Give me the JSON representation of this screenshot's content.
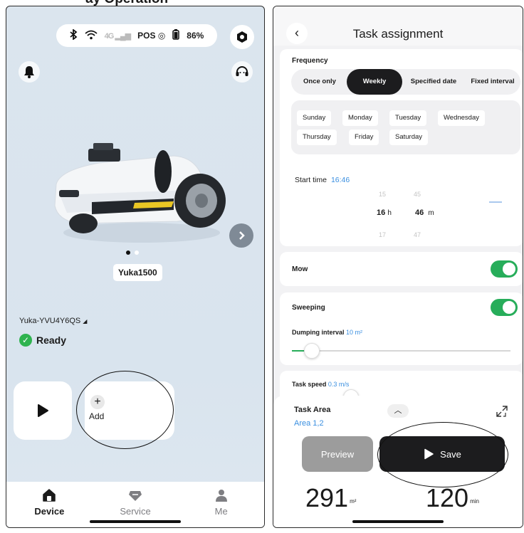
{
  "caption": "ay Operation",
  "left": {
    "status": {
      "bluetooth": "bluetooth-icon",
      "wifi": "wifi-icon",
      "cellular": "4G",
      "pos": "POS",
      "battery_pct": "86%"
    },
    "model": "Yuka1500",
    "carousel": {
      "count": 2,
      "active": 0
    },
    "device_id": "Yuka-YVU4Y6QS",
    "status_text": "Ready",
    "add_label": "Add",
    "nav": [
      {
        "label": "Device",
        "icon": "home-icon",
        "active": true
      },
      {
        "label": "Service",
        "icon": "diamond-icon",
        "active": false
      },
      {
        "label": "Me",
        "icon": "person-icon",
        "active": false
      }
    ],
    "colors": {
      "accent": "#2fb34f",
      "background": "#dbe5ee"
    }
  },
  "right": {
    "title": "Task assignment",
    "frequency_label": "Frequency",
    "frequency_options": [
      "Once only",
      "Weekly",
      "Specified date",
      "Fixed interval"
    ],
    "frequency_selected": "Weekly",
    "days_row1": [
      "Sunday",
      "Monday",
      "Tuesday",
      "Wednesday"
    ],
    "days_row2": [
      "Thursday",
      "Friday",
      "Saturday"
    ],
    "start_time_label": "Start time",
    "start_time_value": "16:46",
    "picker": {
      "hour_prev": "15",
      "hour": "16",
      "hour_next": "17",
      "h_unit": "h",
      "min_prev": "45",
      "min": "46",
      "min_next": "47",
      "m_unit": "m"
    },
    "mow_label": "Mow",
    "mow_on": true,
    "sweeping_label": "Sweeping",
    "sweeping_on": true,
    "dumping_label": "Dumping interval",
    "dumping_value": "10 m²",
    "dumping_fraction": 0.09,
    "speed_label": "Task speed",
    "speed_value": "0.3 m/s",
    "speed_fraction": 0.27,
    "task_area_label": "Task Area",
    "task_area_value": "Area 1,2",
    "preview_label": "Preview",
    "save_label": "Save",
    "area_value": "291",
    "area_unit": "m²",
    "time_value": "120",
    "time_unit": "min",
    "colors": {
      "accent": "#27ad5a",
      "link": "#3a8fe0",
      "dark": "#1c1c1e"
    }
  }
}
